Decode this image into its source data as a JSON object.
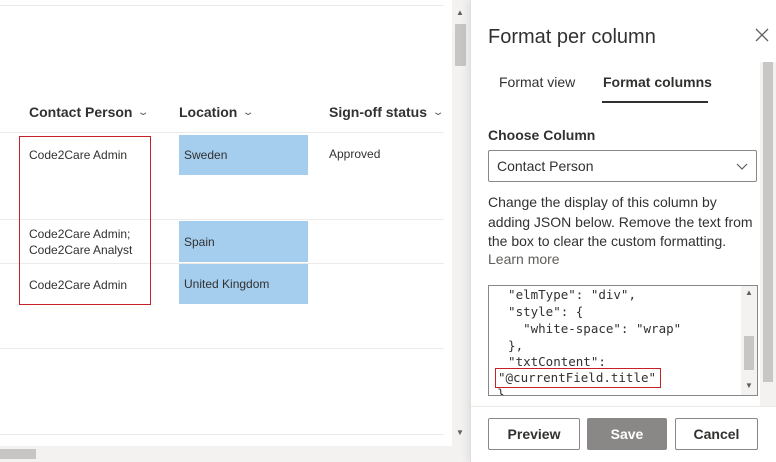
{
  "list": {
    "columns": {
      "contact_person": "Contact Person",
      "location": "Location",
      "signoff": "Sign-off status"
    },
    "rows": [
      {
        "contact": "Code2Care Admin",
        "location": "Sweden",
        "status": "Approved"
      },
      {
        "contact_line1": "Code2Care Admin;",
        "contact_line2": "Code2Care Analyst",
        "location": "Spain"
      },
      {
        "contact": "Code2Care Admin",
        "location": "United Kingdom"
      }
    ]
  },
  "panel": {
    "title": "Format per column",
    "tabs": [
      "Format view",
      "Format columns"
    ],
    "active_tab": "Format columns",
    "choose_label": "Choose Column",
    "dropdown_value": "Contact Person",
    "description": "Change the display of this column by adding JSON below. Remove the text from the box to clear the custom formatting.",
    "learn_more": "Learn more",
    "code_lines": [
      "  \"elmType\": \"div\",",
      "  \"style\": {",
      "    \"white-space\": \"wrap\"",
      "  },",
      "  \"txtContent\":",
      "\"@currentField.title\"",
      "}"
    ],
    "buttons": {
      "preview": "Preview",
      "save": "Save",
      "cancel": "Cancel"
    }
  },
  "colors": {
    "highlight": "#a4cdee",
    "annotation_red": "#c82027",
    "save_disabled": "#8a8886"
  },
  "icons": [
    "chevron-down-icon",
    "close-icon"
  ]
}
